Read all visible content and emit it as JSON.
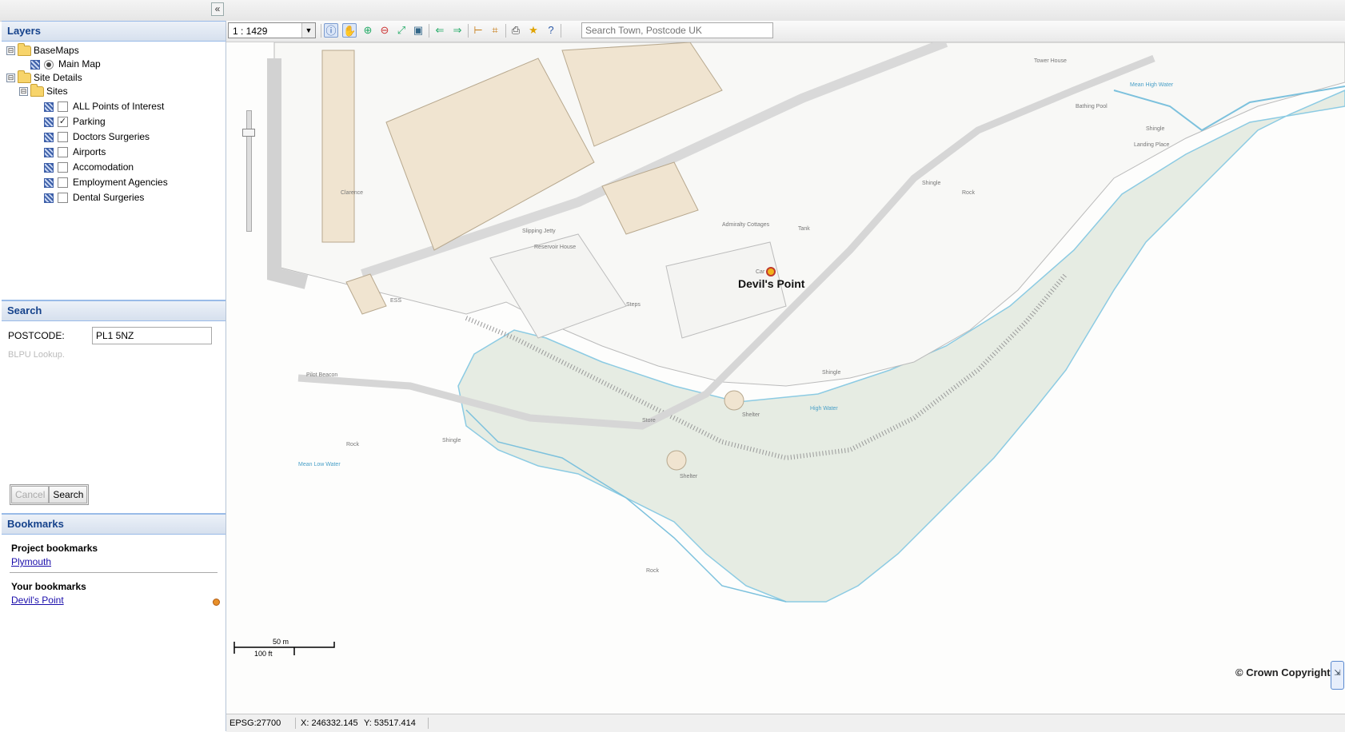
{
  "layers": {
    "title": "Layers",
    "tree": [
      {
        "label": "BaseMaps",
        "type": "folder"
      },
      {
        "label": "Main Map",
        "type": "radio",
        "selected": true
      },
      {
        "label": "Site Details",
        "type": "folder"
      },
      {
        "label": "Sites",
        "type": "folder"
      },
      {
        "label": "ALL Points of Interest",
        "type": "checkbox",
        "checked": false
      },
      {
        "label": "Parking",
        "type": "checkbox",
        "checked": true
      },
      {
        "label": "Doctors Surgeries",
        "type": "checkbox",
        "checked": false
      },
      {
        "label": "Airports",
        "type": "checkbox",
        "checked": false
      },
      {
        "label": "Accomodation",
        "type": "checkbox",
        "checked": false
      },
      {
        "label": "Employment Agencies",
        "type": "checkbox",
        "checked": false
      },
      {
        "label": "Dental Surgeries",
        "type": "checkbox",
        "checked": false
      }
    ],
    "toggle_symbol": "⊟",
    "check_mark": "✓"
  },
  "search": {
    "title": "Search",
    "postcode_label": "POSTCODE:",
    "postcode_value": "PL1 5NZ",
    "blpu_text": "BLPU Lookup.",
    "cancel_label": "Cancel",
    "search_label": "Search"
  },
  "bookmarks": {
    "title": "Bookmarks",
    "project_title": "Project bookmarks",
    "project_items": [
      "Plymouth"
    ],
    "your_title": "Your bookmarks",
    "your_items": [
      "Devil's Point"
    ]
  },
  "toolbar": {
    "scale": "1 : 1429",
    "scale_arrow": "▼",
    "search_placeholder": "Search Town, Postcode UK",
    "icons": [
      "info-icon",
      "pan-icon",
      "zoom-in-icon",
      "zoom-out-icon",
      "zoom-extent-icon",
      "overview-map-icon",
      "back-arrow-icon",
      "forward-arrow-icon",
      "measure-distance-icon",
      "measure-area-icon",
      "print-icon",
      "favourite-star-icon",
      "help-icon"
    ]
  },
  "collapse_symbol": "«",
  "map": {
    "place_label": "Devil's Point",
    "marker_label": "Car",
    "copyright": "© Crown Copyright",
    "scale_bar_top": "50 m",
    "scale_bar_bottom": "100 ft",
    "labels": [
      "Clarence",
      "Admiralty Cottages",
      "Reservoir House",
      "Slipping Jetty",
      "Shelter",
      "Shelter",
      "Shingle",
      "Shingle",
      "Shingle",
      "Shingle",
      "Rock",
      "Rock",
      "Rock",
      "Tower House",
      "Bathing Pool",
      "Landing Place",
      "Pilot Beacon",
      "Mean High Water",
      "Mean Low Water",
      "High Water",
      "Steps",
      "Tank",
      "Store",
      "ESS"
    ],
    "colors": {
      "building": "#f0e4d0",
      "building_stroke": "#b7a88e",
      "foreshore": "#e8ede6",
      "water_line": "#7cc1dd",
      "road": "#cfcfcf",
      "marker": "#f2b31b"
    }
  },
  "status": {
    "epsg": "EPSG:27700",
    "x": "X: 246332.145",
    "y": "Y: 53517.414"
  }
}
